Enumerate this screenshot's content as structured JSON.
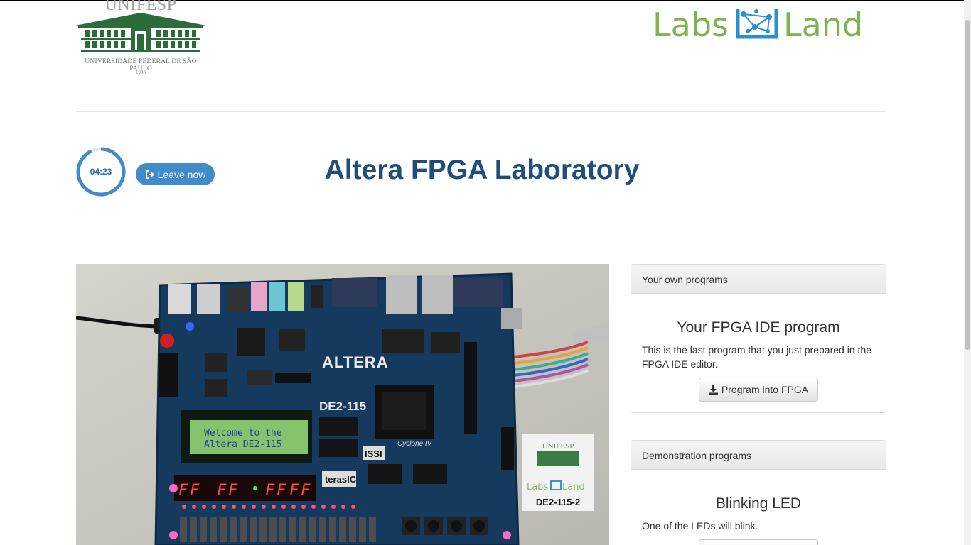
{
  "header": {
    "unifesp": {
      "name": "UNIFESP",
      "subtitle": "UNIVERSIDADE FEDERAL DE SÃO PAULO",
      "year": "1933",
      "color": "#2e6b3a"
    },
    "labsland": {
      "labs": "Labs",
      "land": "Land",
      "green": "#7fb34e",
      "blue": "#2a8fd0"
    }
  },
  "session": {
    "timer_value": "04:23",
    "timer_progress": 0.93,
    "leave_label": "Leave now"
  },
  "page_title": "Altera FPGA Laboratory",
  "board": {
    "lcd_line1": "Welcome to the",
    "lcd_line2": "Altera DE2-115",
    "brand": "ALTERA",
    "model": "DE2-115",
    "chip": "Cyclone IV",
    "issi": "ISSI",
    "terasic": "terasIC",
    "seven_segment": [
      "F",
      "F",
      "F",
      "F",
      "F",
      "F",
      "F",
      "F"
    ],
    "label_card": {
      "name": "UNIFESP",
      "labs": "Labs",
      "land": "Land",
      "id": "DE2-115-2"
    }
  },
  "panels": {
    "own_programs": {
      "header": "Your own programs",
      "title": "Your FPGA IDE program",
      "description": "This is the last program that you just prepared in the FPGA IDE editor.",
      "button": "Program into FPGA"
    },
    "demo_programs": {
      "header": "Demonstration programs",
      "title": "Blinking LED",
      "description": "One of the LEDs will blink."
    }
  }
}
